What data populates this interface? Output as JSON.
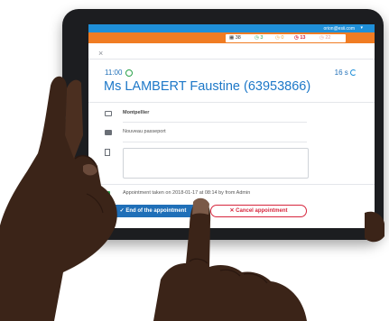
{
  "topbar": {
    "user": "orion@esii.com",
    "caret": "▾"
  },
  "counters": {
    "calendar": "38",
    "green": "3",
    "amber": "0",
    "red": "13",
    "grey": "22"
  },
  "close": "×",
  "appointment": {
    "time": "11:00",
    "duration": "16 s",
    "customer": "Ms LAMBERT Faustine (63953866)",
    "location": "Montpellier",
    "service": "Nouveau passeport",
    "notes": "",
    "taken_info": "Appointment taken on 2018-01-17 at 08:14 by from Admin"
  },
  "buttons": {
    "end": "✓ End of the appointment",
    "cancel": "✕ Cancel appointment"
  },
  "colors": {
    "brand_blue": "#1f8fd8",
    "orange": "#f07c23",
    "danger": "#d7263d",
    "success": "#2aa24a"
  }
}
